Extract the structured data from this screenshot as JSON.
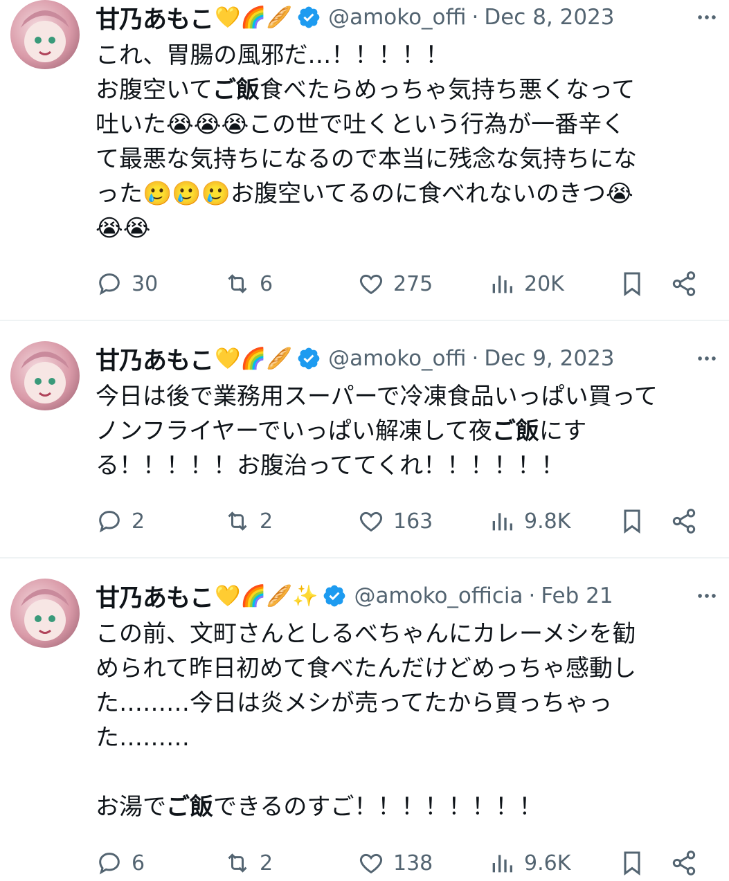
{
  "tweets": [
    {
      "name": "甘乃あもこ",
      "emojis": "💛🌈🥖",
      "handle": "@amoko_offi",
      "date": "Dec 8, 2023",
      "body_html": "これ、胃腸の風邪だ…！！！！！\nお腹空いて<b>ご飯</b>食べたらめっちゃ気持ち悪くなって\n吐いた😭😭😭この世で吐くという行為が一番辛く\nて最悪な気持ちになるので本当に残念な気持ちにな\nった🥲🥲🥲お腹空いてるのに食べれないのきつ😭\n😭😭",
      "replies": "30",
      "reposts": "6",
      "likes": "275",
      "views": "20K"
    },
    {
      "name": "甘乃あもこ",
      "emojis": "💛🌈🥖",
      "handle": "@amoko_offi",
      "date": "Dec 9, 2023",
      "body_html": "今日は後で業務用スーパーで冷凍食品いっぱい買って\nノンフライヤーでいっぱい解凍して夜<b>ご飯</b>にす\nる！！！！！お腹治っててくれ！！！！！！",
      "replies": "2",
      "reposts": "2",
      "likes": "163",
      "views": "9.8K"
    },
    {
      "name": "甘乃あもこ",
      "emojis": "💛🌈🥖✨",
      "handle": "@amoko_officia",
      "date": "Feb 21",
      "body_html": "この前、文町さんとしるべちゃんにカレーメシを勧\nめられて昨日初めて食べたんだけどめっちゃ感動し\nた………今日は炎メシが売ってたから買っちゃっ\nた………\n\nお湯で<b>ご飯</b>できるのすご！！！！！！！！",
      "replies": "6",
      "reposts": "2",
      "likes": "138",
      "views": "9.6K"
    }
  ],
  "colors": {
    "text": "#0f1419",
    "secondary": "#536471",
    "verified": "#1d9bf0",
    "divider": "#eff3f4"
  },
  "icons": [
    "reply-icon",
    "repost-icon",
    "like-icon",
    "views-icon",
    "bookmark-icon",
    "share-icon",
    "verified-badge-icon",
    "more-icon"
  ]
}
